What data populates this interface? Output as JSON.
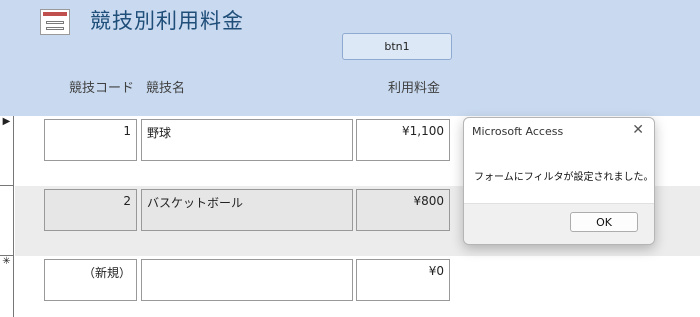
{
  "form": {
    "title": "競技別利用料金"
  },
  "buttons": {
    "btn1": "btn1"
  },
  "columns": {
    "code": "競技コード",
    "name": "競技名",
    "fee": "利用料金"
  },
  "rows": [
    {
      "code": "1",
      "name": "野球",
      "fee": "¥1,100",
      "selector": "▶"
    },
    {
      "code": "2",
      "name": "バスケットボール",
      "fee": "¥800",
      "selector": ""
    },
    {
      "code": "（新規）",
      "name": "",
      "fee": "¥0",
      "selector": "✳"
    }
  ],
  "dialog": {
    "title": "Microsoft Access",
    "close": "✕",
    "message": "フォームにフィルタが設定されました。",
    "ok": "OK"
  }
}
